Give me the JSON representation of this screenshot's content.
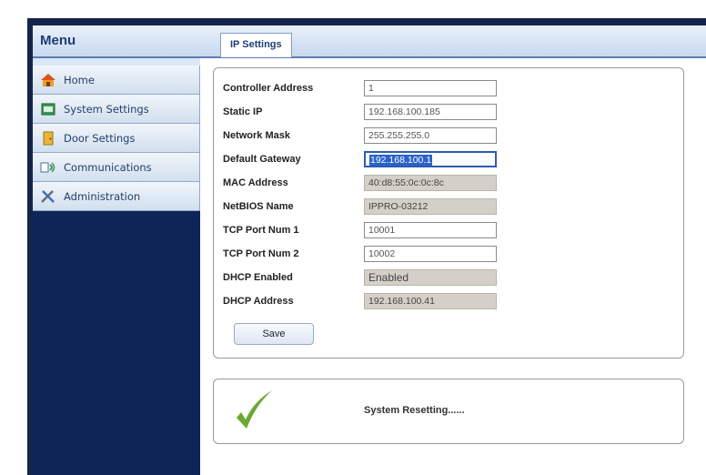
{
  "menu": {
    "title": "Menu",
    "items": [
      {
        "label": "Home",
        "icon": "home-icon"
      },
      {
        "label": "System Settings",
        "icon": "system-settings-icon"
      },
      {
        "label": "Door Settings",
        "icon": "door-icon"
      },
      {
        "label": "Communications",
        "icon": "communications-icon"
      },
      {
        "label": "Administration",
        "icon": "tools-icon"
      }
    ]
  },
  "tab": {
    "label": "IP Settings"
  },
  "form": {
    "fields": [
      {
        "label": "Controller Address",
        "value": "1"
      },
      {
        "label": "Static IP",
        "value": "192.168.100.185"
      },
      {
        "label": "Network Mask",
        "value": "255.255.255.0"
      },
      {
        "label": "Default Gateway",
        "value": "192.168.100.1"
      },
      {
        "label": "MAC Address",
        "value": "40:d8:55:0c:0c:8c"
      },
      {
        "label": "NetBIOS Name",
        "value": "IPPRO-03212"
      },
      {
        "label": "TCP Port Num 1",
        "value": "10001"
      },
      {
        "label": "TCP Port Num 2",
        "value": "10002"
      },
      {
        "label": "DHCP Enabled",
        "value": "Enabled"
      },
      {
        "label": "DHCP Address",
        "value": "192.168.100.41"
      }
    ],
    "save_label": "Save"
  },
  "status": {
    "text": "System Resetting......",
    "icon": "checkmark-icon"
  },
  "colors": {
    "sidebar": "#0f2557",
    "accent": "#2b63c9",
    "check": "#6aa832"
  }
}
